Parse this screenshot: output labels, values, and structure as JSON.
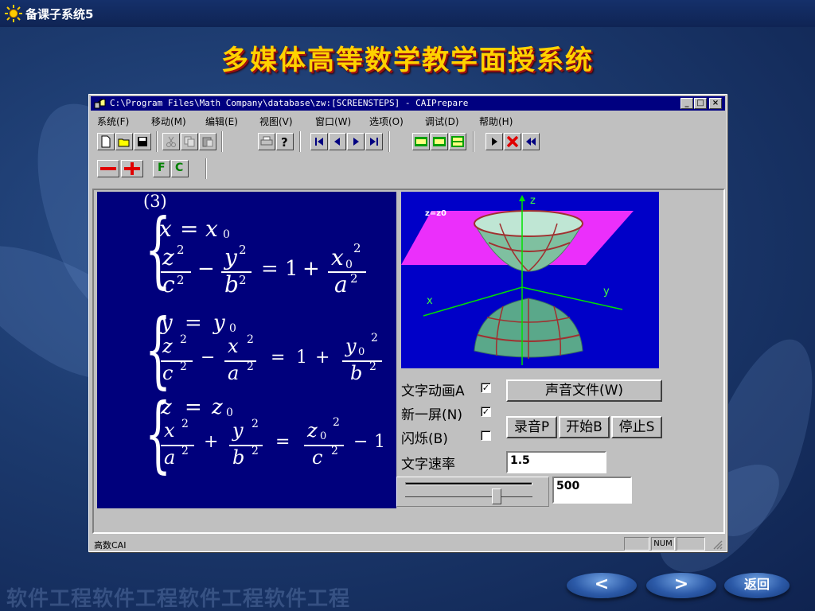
{
  "app": {
    "label": "备课子系统5"
  },
  "slide": {
    "title": "多媒体高等数学教学面授系统"
  },
  "window": {
    "title": "C:\\Program Files\\Math Company\\database\\zw:[SCREENSTEPS] - CAIPrepare",
    "controls": {
      "minimize": "_",
      "maximize": "□",
      "close": "×"
    }
  },
  "menu": [
    "系统(F)",
    "移动(M)",
    "编辑(E)",
    "视图(V)",
    "窗口(W)",
    "选项(O)",
    "调试(D)",
    "帮助(H)"
  ],
  "toolbar2": {
    "f_label": "F",
    "c_label": "C"
  },
  "math": {
    "part_label": "(3)",
    "sys1": {
      "eq1_lhs": "x",
      "eq1_rhs": "x",
      "sub0": "0",
      "n1": "z",
      "d1": "c",
      "n2": "y",
      "d2": "b",
      "n3": "x",
      "d3": "a",
      "one": "1",
      "sq": "2"
    },
    "sys2": {
      "lhs": "y",
      "rhs": "y",
      "sub0": "0",
      "n1": "z",
      "d1": "c",
      "n2": "x",
      "d2": "a",
      "n3": "y",
      "d3": "b",
      "one": "1",
      "sq": "2"
    },
    "sys3": {
      "lhs": "z",
      "rhs": "z",
      "sub0": "0",
      "n1": "x",
      "d1": "a",
      "n2": "y",
      "d2": "b",
      "n3": "z",
      "d3": "c",
      "one": "1",
      "sq": "2"
    },
    "ops": {
      "eq": "=",
      "minus": "−",
      "plus": "+"
    }
  },
  "plot": {
    "axis_z": "z",
    "axis_x": "x",
    "axis_y": "y",
    "plane_label": "z=z0"
  },
  "controls": {
    "text_anim": "文字动画A",
    "text_anim_checked": true,
    "new_screen": "新一屏(N)",
    "new_screen_checked": true,
    "flash": "闪烁(B)",
    "flash_checked": false,
    "text_rate": "文字速率",
    "sound_file_button": "声音文件(W)",
    "record_button": "录音P",
    "start_button": "开始B",
    "stop_button": "停止S",
    "rate_value": "1.5",
    "slider_value": "500",
    "slider_position": 0.72
  },
  "status": {
    "text": "高数CAI",
    "num": "NUM"
  },
  "nav": {
    "prev": "<",
    "next": ">",
    "back": "返回"
  },
  "watermark": {
    "text": "软件工程软件工程软件工程软件工程"
  }
}
